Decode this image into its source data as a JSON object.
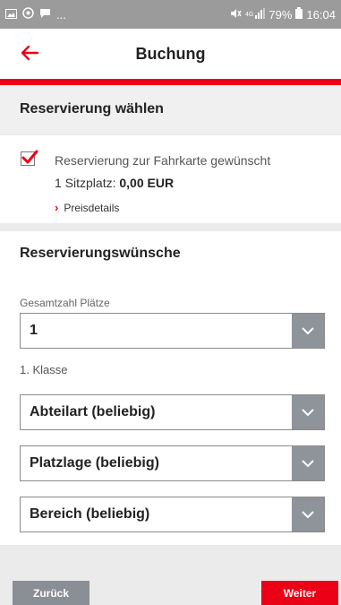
{
  "status_bar": {
    "left_icons": [
      "image-icon",
      "target-icon",
      "chat-icon"
    ],
    "left_ellipsis": "...",
    "battery": "79%",
    "time": "16:04"
  },
  "header": {
    "title": "Buchung"
  },
  "colors": {
    "accent": "#ec0016",
    "select_arrow_bg": "#8f939a",
    "button_back_bg": "#8a8e95"
  },
  "reservation_section": {
    "title": "Reservierung wählen",
    "checkbox_checked": true,
    "checkbox_label": "Reservierung zur Fahrkarte gewünscht",
    "seat_prefix": "1 Sitzplatz: ",
    "seat_price": "0,00 EUR",
    "price_details_link": "Preisdetails"
  },
  "wishes_section": {
    "title": "Reservierungswünsche",
    "seats_label": "Gesamtzahl Plätze",
    "seats_value": "1",
    "class_label": "1. Klasse",
    "compartment_value": "Abteilart (beliebig)",
    "position_value": "Platzlage (beliebig)",
    "area_value": "Bereich (beliebig)"
  },
  "buttons": {
    "back": "Zurück",
    "next": "Weiter"
  }
}
